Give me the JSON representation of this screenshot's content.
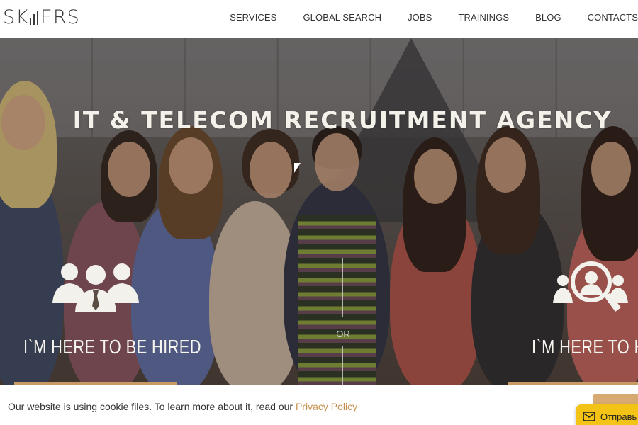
{
  "header": {
    "logo_text_left": "SK",
    "logo_text_right": "ERS",
    "nav": [
      "SERVICES",
      "GLOBAL SEARCH",
      "JOBS",
      "TRAININGS",
      "BLOG",
      "CONTACTS"
    ]
  },
  "hero": {
    "title": "IT & TELECOM RECRUITMENT AGENCY",
    "left_option": {
      "label": "I`M HERE TO BE HIRED",
      "icon": "group-people-icon"
    },
    "right_option": {
      "label": "I`M HERE TO HIRE",
      "icon": "magnifier-person-icon"
    },
    "separator": "OR"
  },
  "cookie_bar": {
    "text": "Our website is using cookie files. To learn more about it, read our ",
    "link": "Privacy Policy"
  },
  "chat_widget": {
    "label": "Отправь",
    "icon": "envelope-icon"
  },
  "colors": {
    "accent": "#c99a66",
    "link": "#c6914f",
    "chat": "#f3c316",
    "header_text": "#333333"
  }
}
